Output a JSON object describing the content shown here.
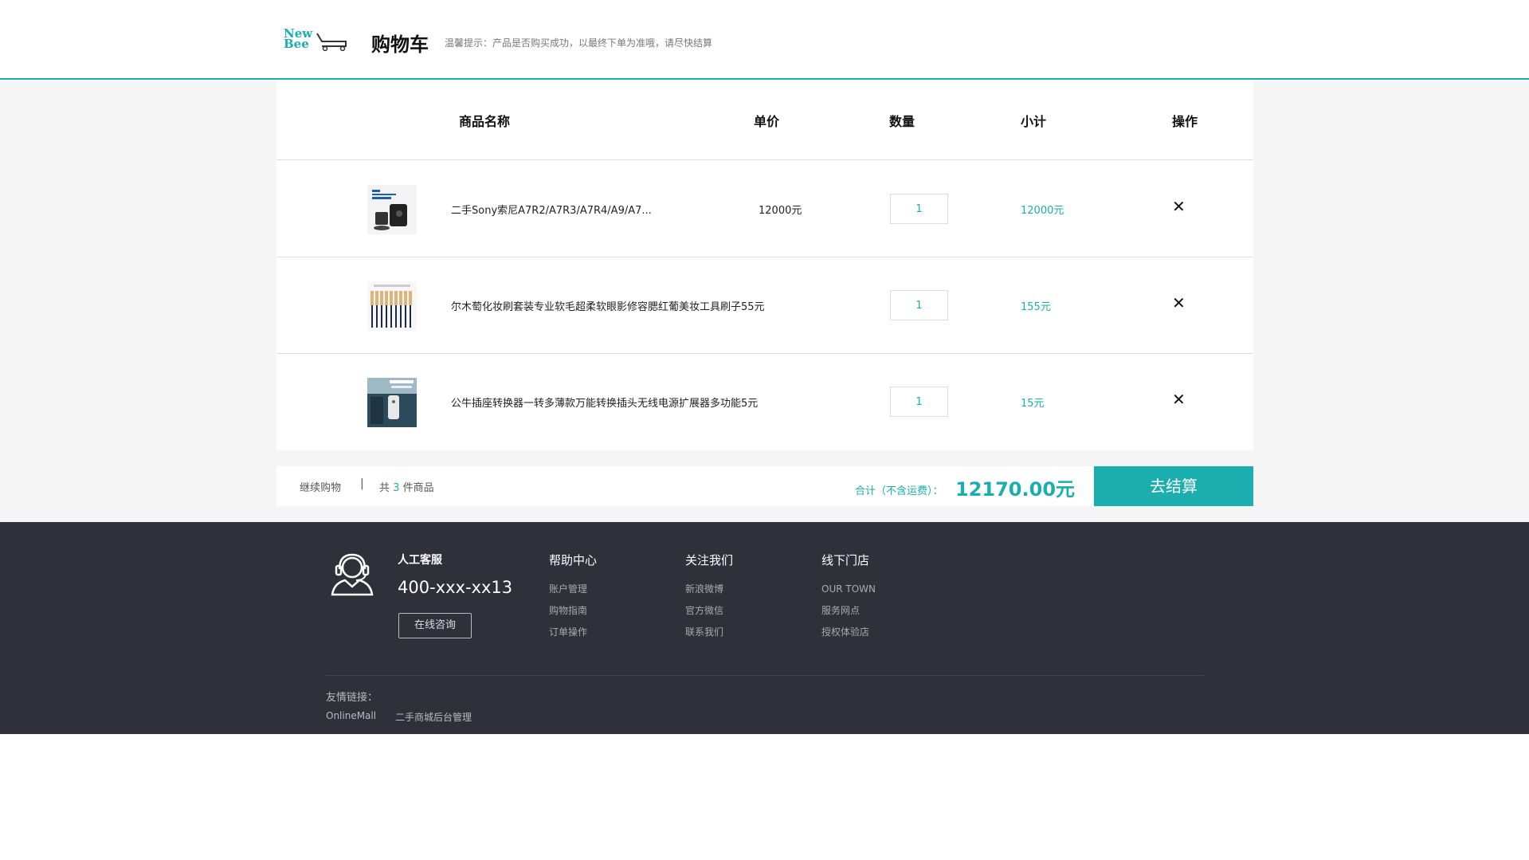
{
  "header": {
    "logo_text_line1": "New",
    "logo_text_line2": "Bee",
    "title": "购物车",
    "tip": "温馨提示：产品是否购买成功，以最终下单为准哦，请尽快结算"
  },
  "table": {
    "columns": [
      "商品名称",
      "单价",
      "数量",
      "小计",
      "操作"
    ],
    "rows": [
      {
        "name": "二手Sony索尼A7R2/A7R3/A7R4/A9/A7...",
        "price": "12000元",
        "qty": "1",
        "subtotal": "12000元",
        "delete": "✕",
        "thumb": "camera-battery-grip"
      },
      {
        "name": "尔木萄化妆刷套装专业软毛超柔软眼影修容腮红葡美妆工具刷子55元",
        "price": "",
        "qty": "1",
        "subtotal": "155元",
        "delete": "✕",
        "thumb": "makeup-brushes"
      },
      {
        "name": "公牛插座转换器一转多薄款万能转换插头无线电源扩展器多功能5元",
        "price": "",
        "qty": "1",
        "subtotal": "15元",
        "delete": "✕",
        "thumb": "power-socket"
      }
    ]
  },
  "summary": {
    "continue": "继续购物",
    "separator": "|",
    "count_prefix": "共",
    "count": "3",
    "count_suffix": "件商品",
    "total_label": "合计（不含运费）：",
    "total_value": "12170.00元",
    "checkout": "去结算"
  },
  "footer": {
    "service_title": "人工客服",
    "phone": "400-xxx-xx13",
    "consult": "在线咨询",
    "columns": [
      {
        "title": "帮助中心",
        "items": [
          "账户管理",
          "购物指南",
          "订单操作"
        ]
      },
      {
        "title": "关注我们",
        "items": [
          "新浪微博",
          "官方微信",
          "联系我们"
        ]
      },
      {
        "title": "线下门店",
        "items": [
          "OUR TOWN",
          "服务网点",
          "授权体验店"
        ]
      }
    ],
    "links_label": "友情链接：",
    "links": [
      "OnlineMall",
      "二手商城后台管理"
    ]
  },
  "colors": {
    "accent": "#1baeae",
    "footer_bg": "#2f3039",
    "page_bg": "#f5f5f5"
  }
}
